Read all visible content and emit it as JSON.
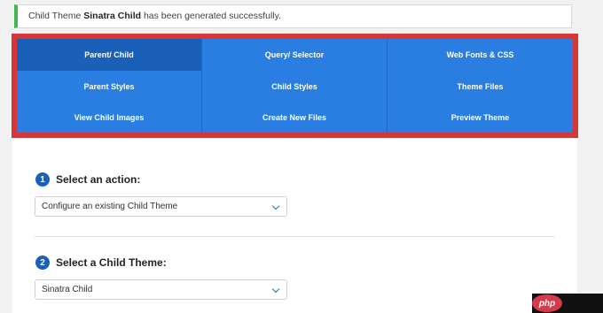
{
  "notice": {
    "prefix": "Child Theme ",
    "theme_name": "Sinatra Child",
    "suffix": " has been generated successfully."
  },
  "tabs": [
    {
      "label": "Parent/ Child",
      "active": true
    },
    {
      "label": "Query/ Selector",
      "active": false
    },
    {
      "label": "Web Fonts & CSS",
      "active": false
    },
    {
      "label": "Parent Styles",
      "active": false
    },
    {
      "label": "Child Styles",
      "active": false
    },
    {
      "label": "Theme Files",
      "active": false
    },
    {
      "label": "View Child Images",
      "active": false
    },
    {
      "label": "Create New Files",
      "active": false
    },
    {
      "label": "Preview Theme",
      "active": false
    }
  ],
  "step1": {
    "number": "1",
    "title": "Select an action:",
    "selected": "Configure an existing Child Theme"
  },
  "step2": {
    "number": "2",
    "title": "Select a Child Theme:",
    "selected": "Sinatra Child"
  },
  "colors": {
    "accent": "#2a7de1",
    "active_tab": "#1a5fb8",
    "highlight_border": "#d63638",
    "notice_border": "#46b450"
  },
  "watermark": "php"
}
